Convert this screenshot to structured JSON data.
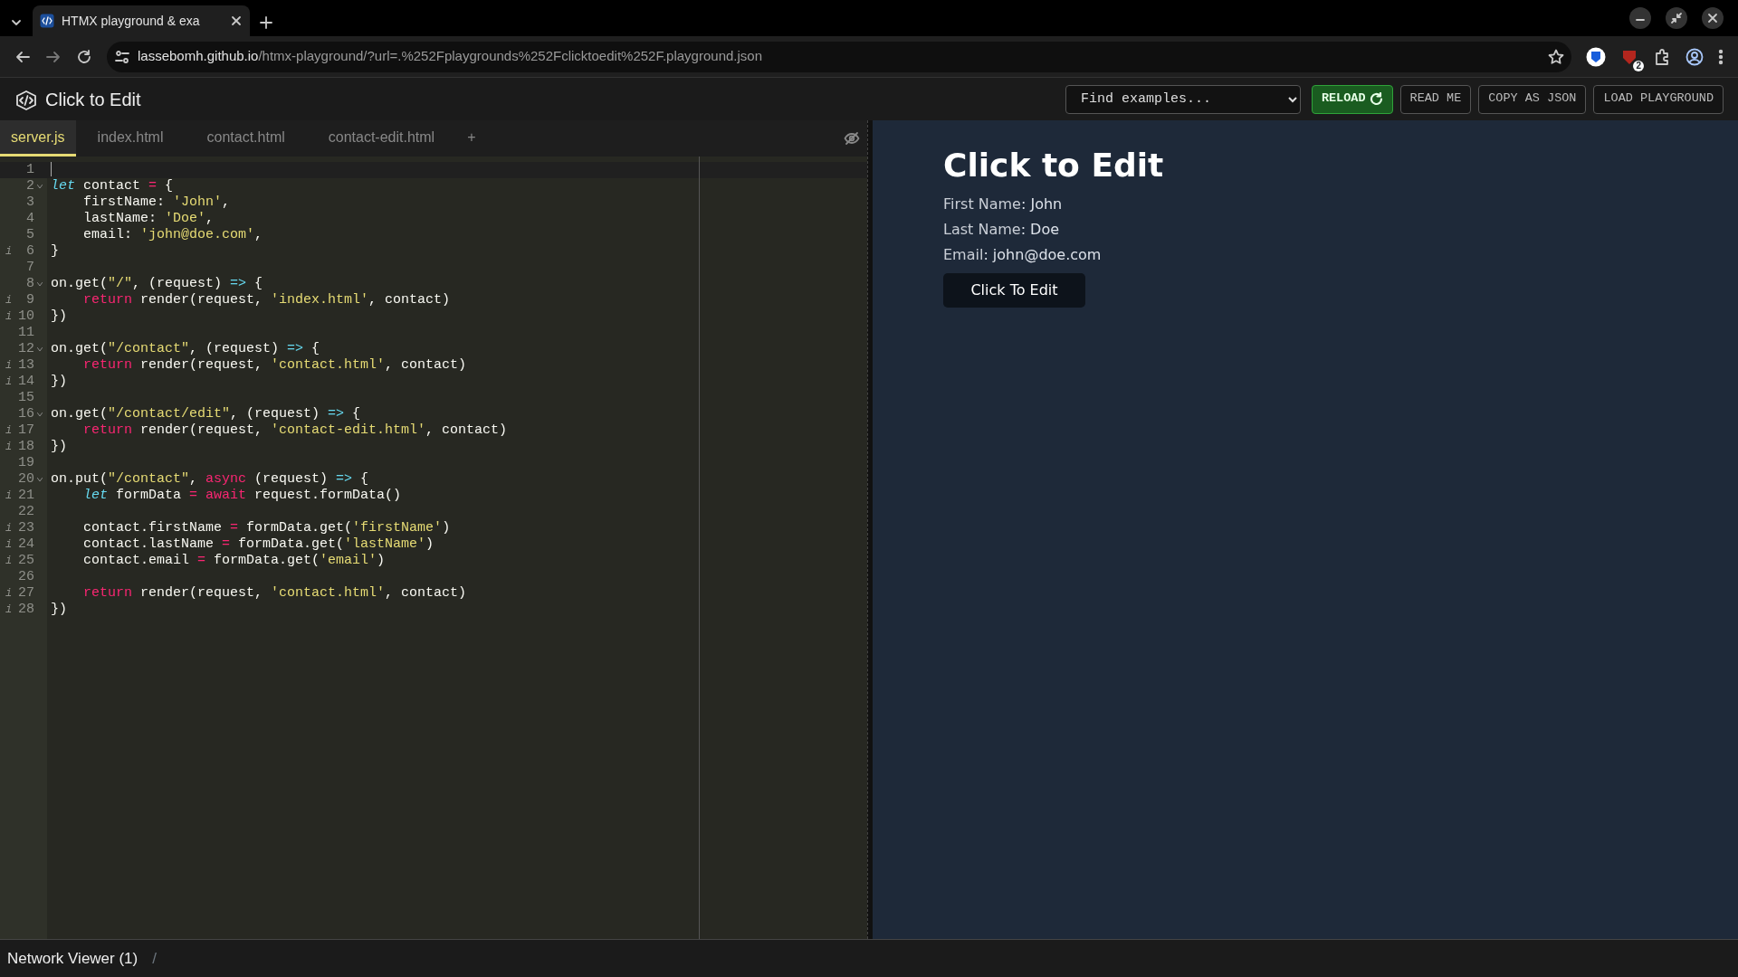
{
  "browser": {
    "tab": {
      "title": "HTMX playground & exa"
    },
    "url_host": "lassebomh.github.io",
    "url_path": "/htmx-playground/?url=.%252Fplaygrounds%252Fclicktoedit%252F.playground.json",
    "extension_badge": "2"
  },
  "header": {
    "title": "Click to Edit",
    "select": {
      "value": "Find examples..."
    },
    "buttons": [
      {
        "label": "RELOAD",
        "kind": "primary"
      },
      {
        "label": "READ ME",
        "kind": "outline"
      },
      {
        "label": "COPY AS JSON",
        "kind": "outline"
      },
      {
        "label": "LOAD PLAYGROUND",
        "kind": "outline"
      }
    ]
  },
  "editor": {
    "tabs": [
      {
        "label": "server.js",
        "selected": true
      },
      {
        "label": "index.html",
        "selected": false
      },
      {
        "label": "contact.html",
        "selected": false
      },
      {
        "label": "contact-edit.html",
        "selected": false
      }
    ],
    "add_tab": "+",
    "lines": [
      {
        "number": "1",
        "active": true,
        "foldable": false
      },
      {
        "number": "2",
        "active": false,
        "foldable": true,
        "tokens": [
          {
            "kind": "storage",
            "text": "let"
          },
          {
            "kind": "plain",
            "text": " contact "
          },
          {
            "kind": "operator",
            "text": "="
          },
          {
            "kind": "plain",
            "text": " {"
          }
        ]
      },
      {
        "number": "3",
        "active": false,
        "foldable": false,
        "tokens": [
          {
            "kind": "plain",
            "text": "    firstName: "
          },
          {
            "kind": "string",
            "text": "'John'"
          },
          {
            "kind": "plain",
            "text": ","
          }
        ]
      },
      {
        "number": "4",
        "active": false,
        "foldable": false,
        "tokens": [
          {
            "kind": "plain",
            "text": "    lastName: "
          },
          {
            "kind": "string",
            "text": "'Doe'"
          },
          {
            "kind": "plain",
            "text": ","
          }
        ]
      },
      {
        "number": "5",
        "active": false,
        "foldable": false,
        "tokens": [
          {
            "kind": "plain",
            "text": "    email: "
          },
          {
            "kind": "string",
            "text": "'john@doe.com'"
          },
          {
            "kind": "plain",
            "text": ","
          }
        ]
      },
      {
        "number": "6",
        "active": false,
        "foldable": false,
        "marker": "i",
        "tokens": [
          {
            "kind": "plain",
            "text": "}"
          }
        ]
      },
      {
        "number": "7",
        "active": false,
        "foldable": false
      },
      {
        "number": "8",
        "active": false,
        "foldable": true,
        "tokens": [
          {
            "kind": "plain",
            "text": "on.get("
          },
          {
            "kind": "string",
            "text": "\"/\""
          },
          {
            "kind": "plain",
            "text": ", (request) "
          },
          {
            "kind": "arrow",
            "text": "=>"
          },
          {
            "kind": "plain",
            "text": " {"
          }
        ]
      },
      {
        "number": "9",
        "active": false,
        "foldable": false,
        "marker": "i",
        "tokens": [
          {
            "kind": "keyword",
            "text": "    return"
          },
          {
            "kind": "plain",
            "text": " render(request, "
          },
          {
            "kind": "string",
            "text": "'index.html'"
          },
          {
            "kind": "plain",
            "text": ", contact)"
          }
        ]
      },
      {
        "number": "10",
        "active": false,
        "foldable": false,
        "marker": "i",
        "tokens": [
          {
            "kind": "plain",
            "text": "})"
          }
        ]
      },
      {
        "number": "11",
        "active": false,
        "foldable": false
      },
      {
        "number": "12",
        "active": false,
        "foldable": true,
        "tokens": [
          {
            "kind": "plain",
            "text": "on.get("
          },
          {
            "kind": "string",
            "text": "\"/contact\""
          },
          {
            "kind": "plain",
            "text": ", (request) "
          },
          {
            "kind": "arrow",
            "text": "=>"
          },
          {
            "kind": "plain",
            "text": " {"
          }
        ]
      },
      {
        "number": "13",
        "active": false,
        "foldable": false,
        "marker": "i",
        "tokens": [
          {
            "kind": "keyword",
            "text": "    return"
          },
          {
            "kind": "plain",
            "text": " render(request, "
          },
          {
            "kind": "string",
            "text": "'contact.html'"
          },
          {
            "kind": "plain",
            "text": ", contact)"
          }
        ]
      },
      {
        "number": "14",
        "active": false,
        "foldable": false,
        "marker": "i",
        "tokens": [
          {
            "kind": "plain",
            "text": "})"
          }
        ]
      },
      {
        "number": "15",
        "active": false,
        "foldable": false
      },
      {
        "number": "16",
        "active": false,
        "foldable": true,
        "tokens": [
          {
            "kind": "plain",
            "text": "on.get("
          },
          {
            "kind": "string",
            "text": "\"/contact/edit\""
          },
          {
            "kind": "plain",
            "text": ", (request) "
          },
          {
            "kind": "arrow",
            "text": "=>"
          },
          {
            "kind": "plain",
            "text": " {"
          }
        ]
      },
      {
        "number": "17",
        "active": false,
        "foldable": false,
        "marker": "i",
        "tokens": [
          {
            "kind": "keyword",
            "text": "    return"
          },
          {
            "kind": "plain",
            "text": " render(request, "
          },
          {
            "kind": "string",
            "text": "'contact-edit.html'"
          },
          {
            "kind": "plain",
            "text": ", contact)"
          }
        ]
      },
      {
        "number": "18",
        "active": false,
        "foldable": false,
        "marker": "i",
        "tokens": [
          {
            "kind": "plain",
            "text": "})"
          }
        ]
      },
      {
        "number": "19",
        "active": false,
        "foldable": false
      },
      {
        "number": "20",
        "active": false,
        "foldable": true,
        "tokens": [
          {
            "kind": "plain",
            "text": "on.put("
          },
          {
            "kind": "string",
            "text": "\"/contact\""
          },
          {
            "kind": "plain",
            "text": ", "
          },
          {
            "kind": "keyword",
            "text": "async"
          },
          {
            "kind": "plain",
            "text": " (request) "
          },
          {
            "kind": "arrow",
            "text": "=>"
          },
          {
            "kind": "plain",
            "text": " {"
          }
        ]
      },
      {
        "number": "21",
        "active": false,
        "foldable": false,
        "marker": "i",
        "tokens": [
          {
            "kind": "storage",
            "text": "    let"
          },
          {
            "kind": "plain",
            "text": " formData "
          },
          {
            "kind": "operator",
            "text": "="
          },
          {
            "kind": "keyword",
            "text": " await"
          },
          {
            "kind": "plain",
            "text": " request.formData()"
          }
        ]
      },
      {
        "number": "22",
        "active": false,
        "foldable": false
      },
      {
        "number": "23",
        "active": false,
        "foldable": false,
        "marker": "i",
        "tokens": [
          {
            "kind": "plain",
            "text": "    contact.firstName "
          },
          {
            "kind": "operator",
            "text": "="
          },
          {
            "kind": "plain",
            "text": " formData.get("
          },
          {
            "kind": "string",
            "text": "'firstName'"
          },
          {
            "kind": "plain",
            "text": ")"
          }
        ]
      },
      {
        "number": "24",
        "active": false,
        "foldable": false,
        "marker": "i",
        "tokens": [
          {
            "kind": "plain",
            "text": "    contact.lastName "
          },
          {
            "kind": "operator",
            "text": "="
          },
          {
            "kind": "plain",
            "text": " formData.get("
          },
          {
            "kind": "string",
            "text": "'lastName'"
          },
          {
            "kind": "plain",
            "text": ")"
          }
        ]
      },
      {
        "number": "25",
        "active": false,
        "foldable": false,
        "marker": "i",
        "tokens": [
          {
            "kind": "plain",
            "text": "    contact.email "
          },
          {
            "kind": "operator",
            "text": "="
          },
          {
            "kind": "plain",
            "text": " formData.get("
          },
          {
            "kind": "string",
            "text": "'email'"
          },
          {
            "kind": "plain",
            "text": ")"
          }
        ]
      },
      {
        "number": "26",
        "active": false,
        "foldable": false
      },
      {
        "number": "27",
        "active": false,
        "foldable": false,
        "marker": "i",
        "tokens": [
          {
            "kind": "keyword",
            "text": "    return"
          },
          {
            "kind": "plain",
            "text": " render(request, "
          },
          {
            "kind": "string",
            "text": "'contact.html'"
          },
          {
            "kind": "plain",
            "text": ", contact)"
          }
        ]
      },
      {
        "number": "28",
        "active": false,
        "foldable": false,
        "marker": "i",
        "tokens": [
          {
            "kind": "plain",
            "text": "})"
          }
        ]
      }
    ]
  },
  "preview": {
    "heading": "Click to Edit",
    "fields": [
      {
        "label": "First Name",
        "value": ": John"
      },
      {
        "label": "Last Name",
        "value": ": Doe"
      },
      {
        "label": "Email",
        "value": ": john@doe.com"
      }
    ],
    "button": "Click To Edit"
  },
  "bottom_bar": {
    "title": "Network Viewer (1)",
    "path": "/"
  }
}
